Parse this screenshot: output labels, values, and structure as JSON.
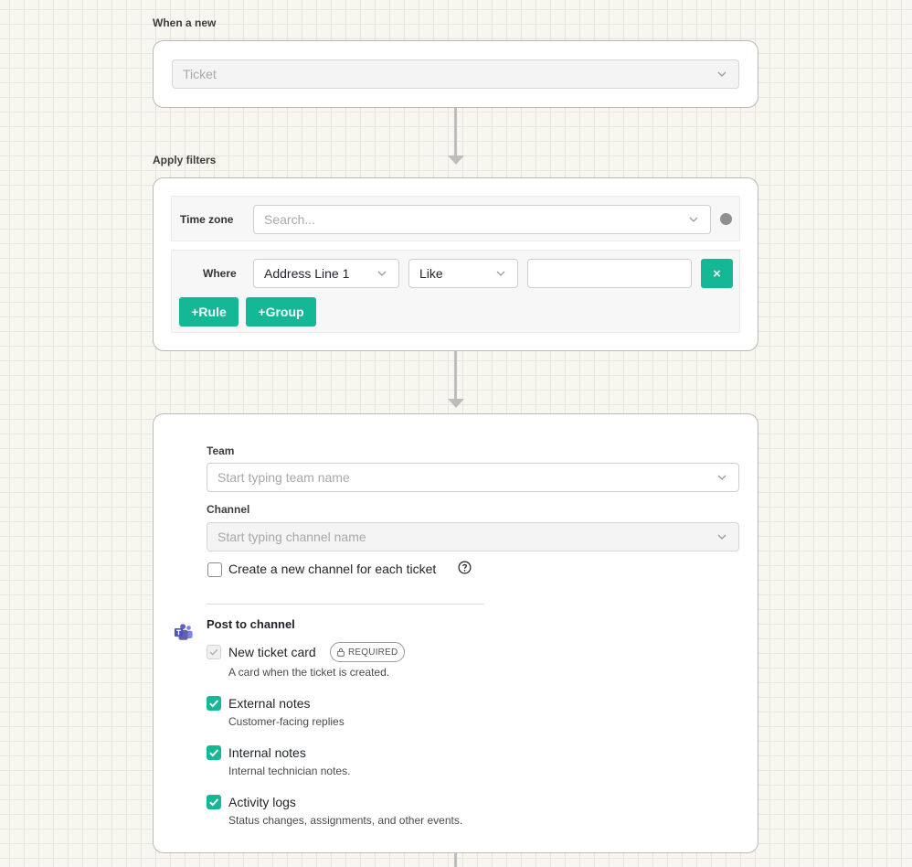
{
  "trigger": {
    "section_label": "When a new",
    "object_value": "Ticket"
  },
  "filters": {
    "section_label": "Apply filters",
    "timezone_label": "Time zone",
    "timezone_placeholder": "Search...",
    "where_label": "Where",
    "field_value": "Address Line 1",
    "operator_value": "Like",
    "value_input": "",
    "remove_label": "×",
    "add_rule_label": "+Rule",
    "add_group_label": "+Group"
  },
  "action": {
    "team_label": "Team",
    "team_placeholder": "Start typing team name",
    "channel_label": "Channel",
    "channel_placeholder": "Start typing channel name",
    "new_channel_label": "Create a new channel for each ticket",
    "new_channel_checked": false,
    "post_heading": "Post to channel",
    "options": [
      {
        "title": "New ticket card",
        "desc": "A card when the ticket is created.",
        "checked": true,
        "required": true,
        "required_label": "REQUIRED"
      },
      {
        "title": "External notes",
        "desc": "Customer-facing replies",
        "checked": true
      },
      {
        "title": "Internal notes",
        "desc": "Internal technician notes.",
        "checked": true
      },
      {
        "title": "Activity logs",
        "desc": "Status changes, assignments, and other events.",
        "checked": true
      }
    ]
  },
  "colors": {
    "accent": "#14b896",
    "teams_purple": "#5b5fc7"
  },
  "icons": [
    "chevron-down-icon",
    "help-icon",
    "lock-icon",
    "check-icon",
    "teams-icon",
    "status-dot-icon"
  ]
}
